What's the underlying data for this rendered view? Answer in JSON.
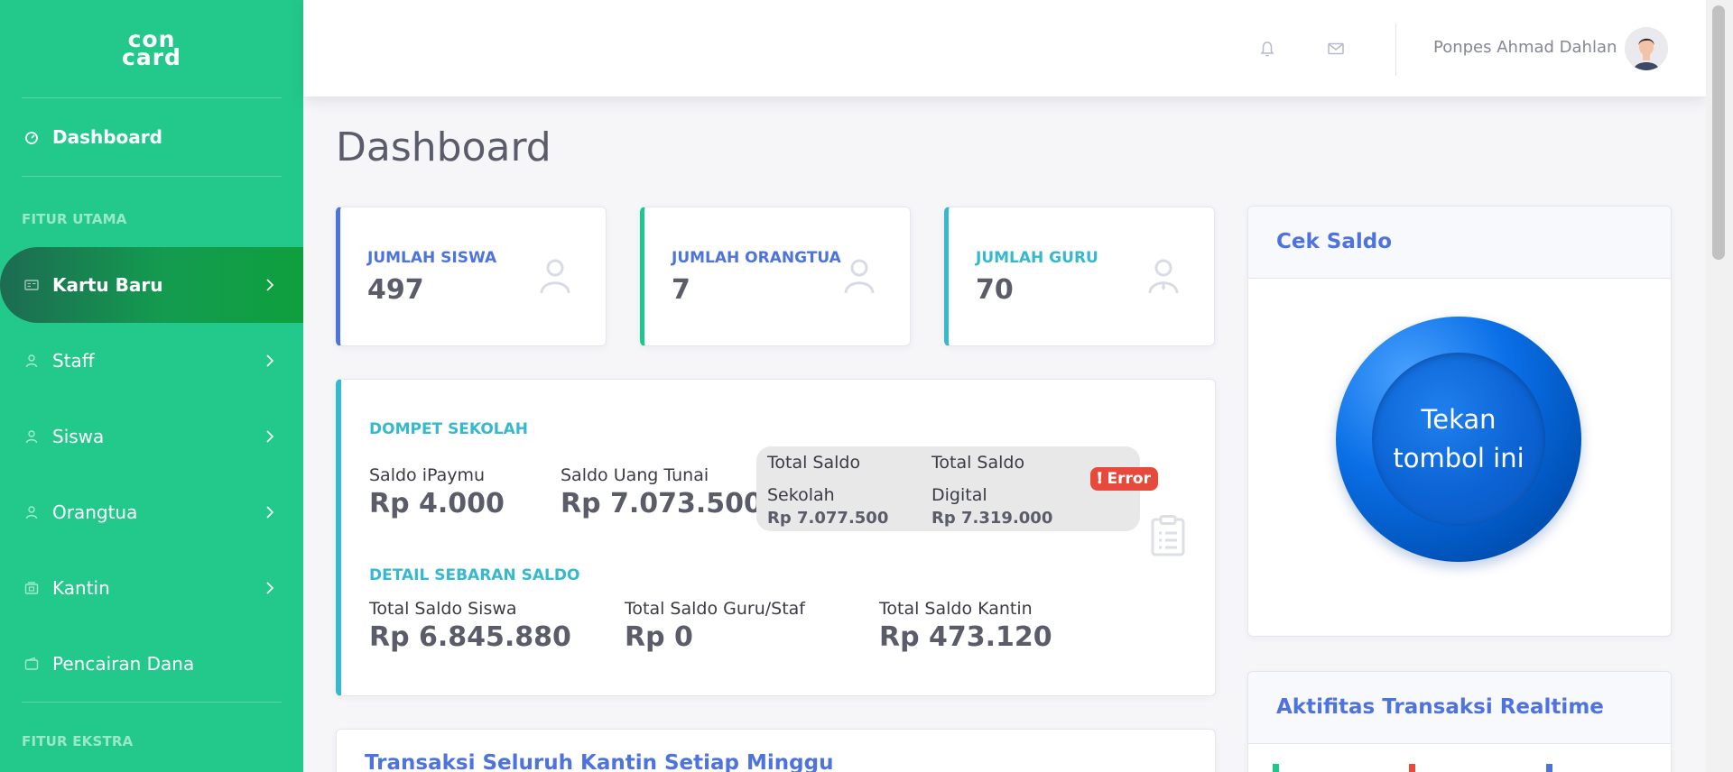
{
  "brand": {
    "logo_line1": "con",
    "logo_line2": "card"
  },
  "sidebar": {
    "dashboard_label": "Dashboard",
    "heading_main": "FITUR UTAMA",
    "heading_extra": "FITUR EKSTRA",
    "items": [
      {
        "label": "Kartu Baru",
        "icon": "id-card-icon",
        "active": true
      },
      {
        "label": "Staff",
        "icon": "user-icon"
      },
      {
        "label": "Siswa",
        "icon": "user-icon"
      },
      {
        "label": "Orangtua",
        "icon": "user-icon"
      },
      {
        "label": "Kantin",
        "icon": "shop-icon"
      },
      {
        "label": "Pencairan Dana",
        "icon": "wallet-icon"
      }
    ]
  },
  "topbar": {
    "user_name": "Ponpes Ahmad Dahlan"
  },
  "page_title": "Dashboard",
  "stats": [
    {
      "label": "JUMLAH SISWA",
      "value": "497",
      "color": "#4e73df"
    },
    {
      "label": "JUMLAH ORANGTUA",
      "value": "7",
      "color": "#1cc88a"
    },
    {
      "label": "JUMLAH GURU",
      "value": "70",
      "color": "#36b9cc"
    }
  ],
  "wallet": {
    "title": "DOMPET SEKOLAH",
    "ipaymu_label": "Saldo iPaymu",
    "ipaymu_value": "Rp 4.000",
    "tunai_label": "Saldo Uang Tunai",
    "tunai_value": "Rp 7.073.500",
    "total_sekolah_l1": "Total Saldo",
    "total_sekolah_l2": "Sekolah",
    "total_sekolah_value": "Rp 7.077.500",
    "total_digital_l1": "Total Saldo",
    "total_digital_l2": "Digital",
    "total_digital_value": "Rp 7.319.000",
    "error_badge": "Error",
    "detail_title": "DETAIL SEBARAN SALDO",
    "siswa_label": "Total Saldo Siswa",
    "siswa_value": "Rp 6.845.880",
    "guru_label": "Total Saldo Guru/Staf",
    "guru_value": "Rp 0",
    "kantin_label": "Total Saldo Kantin",
    "kantin_value": "Rp 473.120"
  },
  "cek_saldo": {
    "title": "Cek Saldo",
    "button_label": "Tekan tombol ini"
  },
  "aktifitas": {
    "title": "Aktifitas Transaksi Realtime",
    "legend_colors": [
      "#1cc88a",
      "#e74a3b",
      "#4e73df"
    ]
  },
  "transaksi": {
    "title": "Transaksi Seluruh Kantin Setiap Minggu"
  }
}
